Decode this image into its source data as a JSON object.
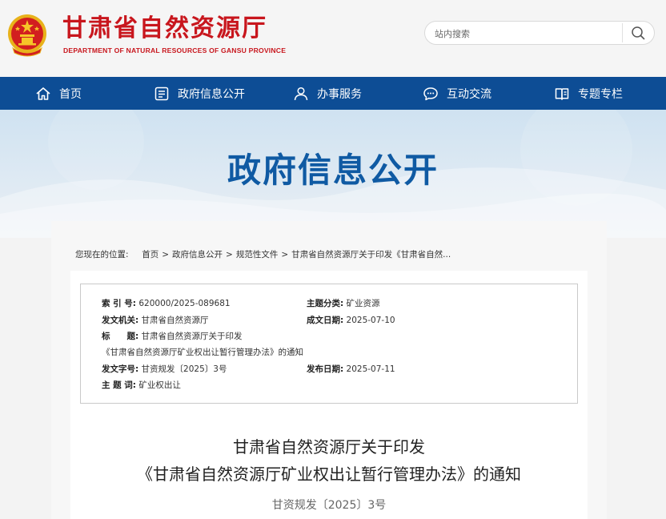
{
  "header": {
    "title_cn": "甘肃省自然资源厅",
    "title_en": "DEPARTMENT OF NATURAL RESOURCES OF GANSU PROVINCE",
    "search_placeholder": "站内搜索"
  },
  "nav": {
    "items": [
      {
        "label": "首页",
        "icon": "home-icon"
      },
      {
        "label": "政府信息公开",
        "icon": "document-list-icon"
      },
      {
        "label": "办事服务",
        "icon": "user-service-icon"
      },
      {
        "label": "互动交流",
        "icon": "chat-icon"
      },
      {
        "label": "专题专栏",
        "icon": "book-icon"
      }
    ]
  },
  "banner": {
    "title": "政府信息公开"
  },
  "breadcrumb": {
    "prefix": "您现在的位置:",
    "items": [
      "首页",
      "政府信息公开",
      "规范性文件",
      "甘肃省自然资源厅关于印发《甘肃省自然..."
    ]
  },
  "meta": {
    "index_label": "索 引 号:",
    "index_value": "620000/2025-089681",
    "topic_label": "主题分类:",
    "topic_value": "矿业资源",
    "issuer_label": "发文机关:",
    "issuer_value": "甘肃省自然资源厅",
    "date_made_label": "成文日期:",
    "date_made_value": "2025-07-10",
    "title_label": "标　　题:",
    "title_value_1": "甘肃省自然资源厅关于印发",
    "title_value_2": "《甘肃省自然资源厅矿业权出让暂行管理办法》的通知",
    "docno_label": "发文字号:",
    "docno_value": "甘资规发〔2025〕3号",
    "date_pub_label": "发布日期:",
    "date_pub_value": "2025-07-11",
    "keyword_label": "主 题 词:",
    "keyword_value": "矿业权出让"
  },
  "document": {
    "title_line1": "甘肃省自然资源厅关于印发",
    "title_line2": "《甘肃省自然资源厅矿业权出让暂行管理办法》的通知",
    "number": "甘资规发〔2025〕3号"
  },
  "colors": {
    "brand_red": "#c8161d",
    "nav_blue": "#0d4d95",
    "banner_title_blue": "#0f5aa3"
  }
}
